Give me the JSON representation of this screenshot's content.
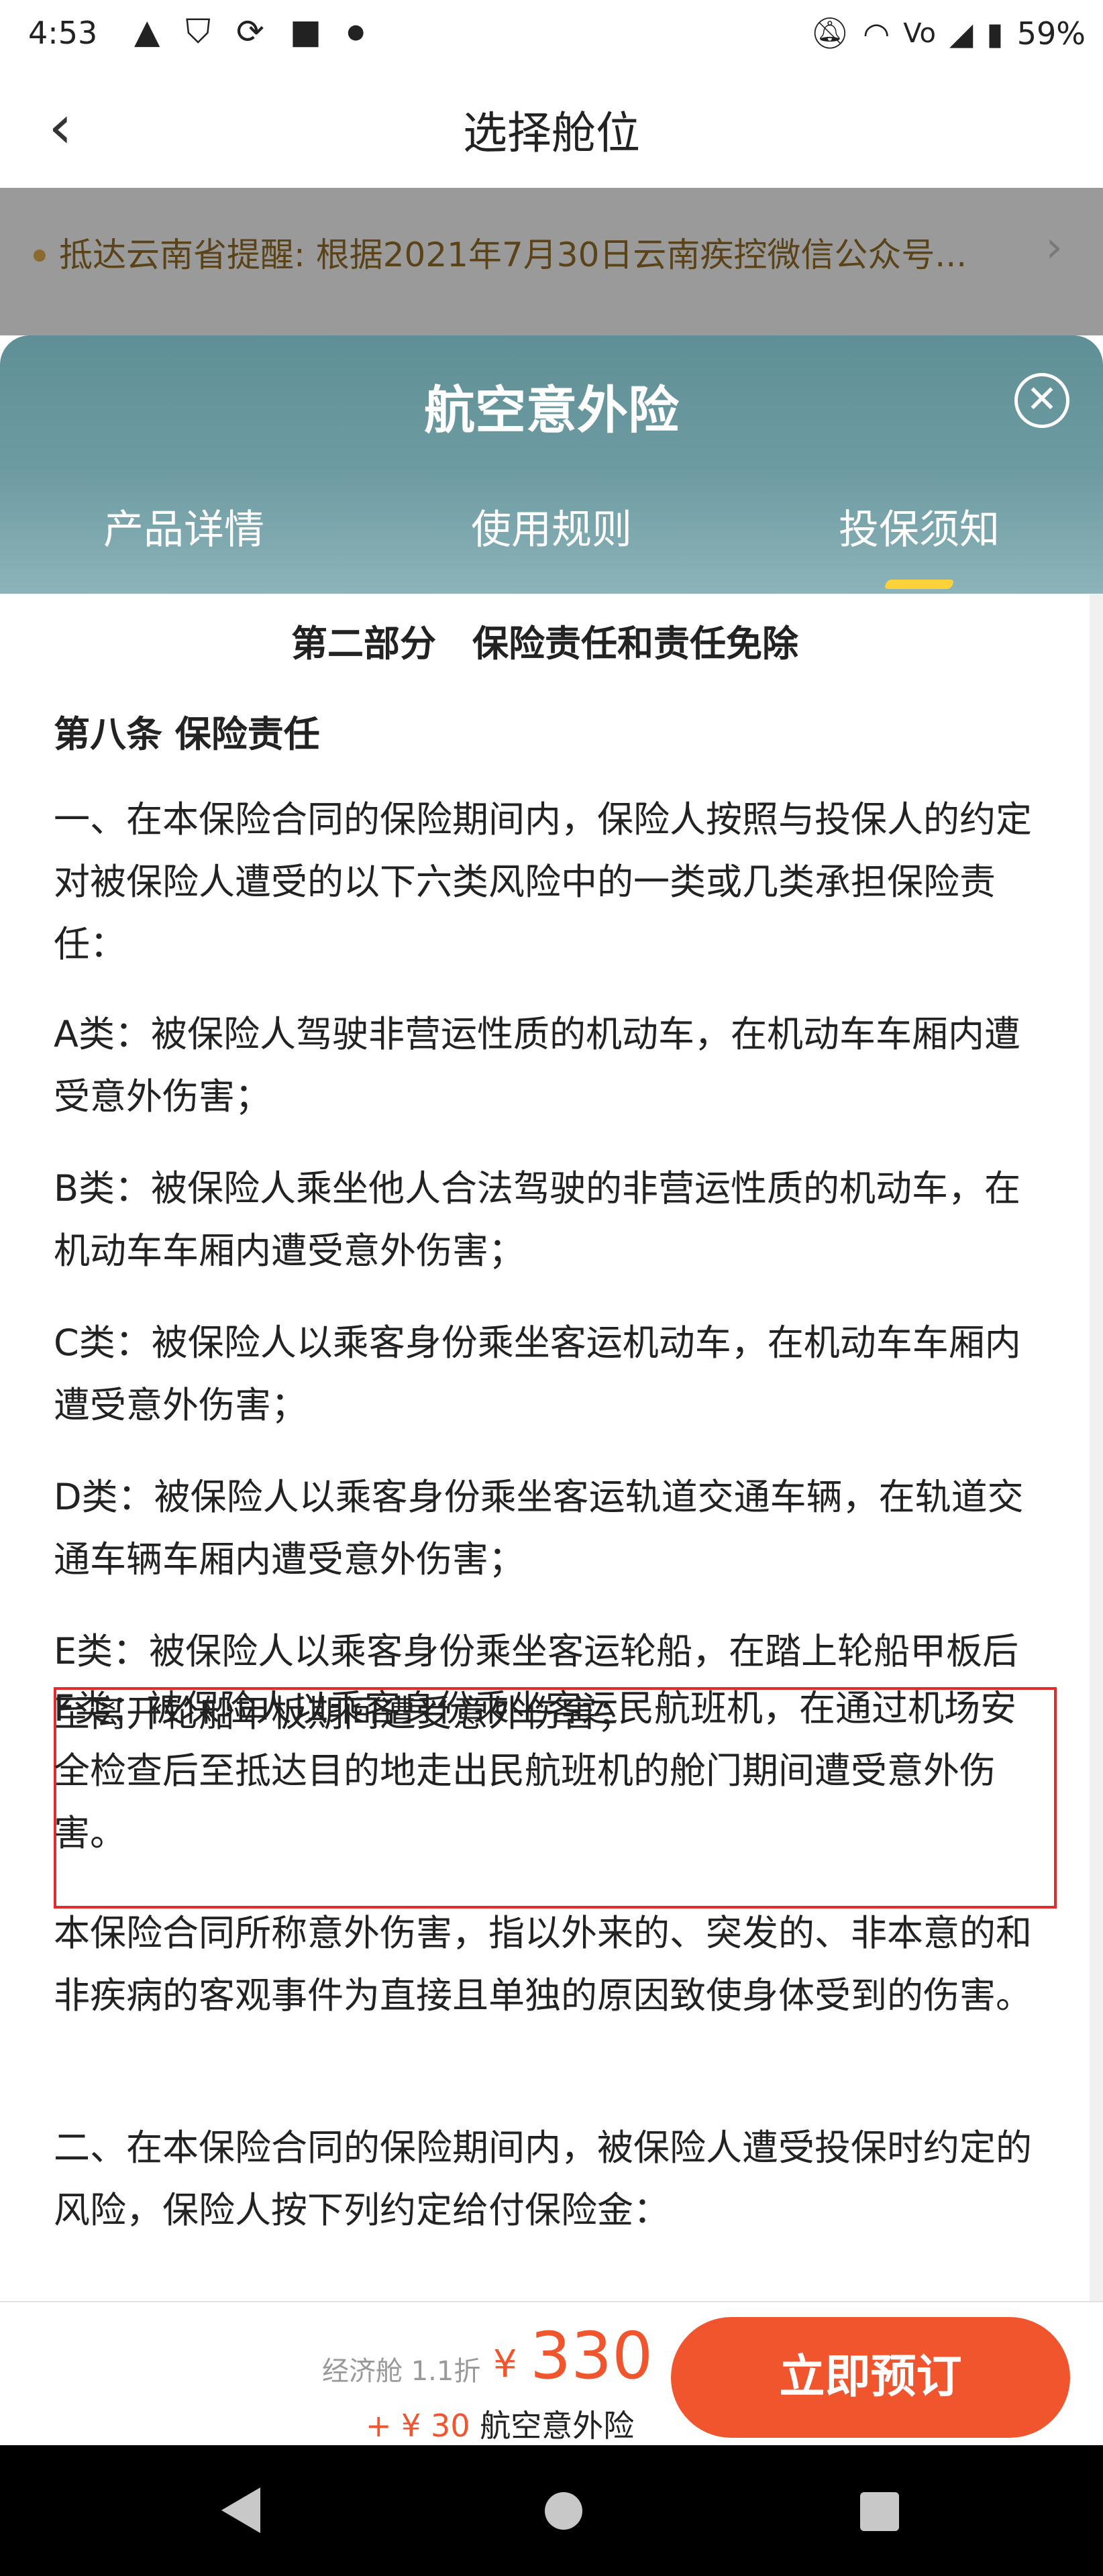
{
  "status_bar": {
    "time": "4:53",
    "battery": "59%",
    "icons_left": [
      "a-icon",
      "shield-icon",
      "sync-icon",
      "square-icon",
      "dot-icon"
    ],
    "icons_right": [
      "mute-icon",
      "wifi-icon",
      "volte-icon",
      "signal-icon",
      "battery-icon"
    ]
  },
  "header": {
    "title": "选择舱位",
    "back_glyph": "‹"
  },
  "notice": {
    "text": "抵达云南省提醒: 根据2021年7月30日云南疾控微信公众号...",
    "arrow_glyph": "›"
  },
  "modal": {
    "title": "航空意外险",
    "close_glyph": "✕",
    "tabs": [
      {
        "label": "产品详情",
        "active": false
      },
      {
        "label": "使用规则",
        "active": false
      },
      {
        "label": "投保须知",
        "active": true
      }
    ],
    "content": {
      "section_title": "第二部分　保险责任和责任免除",
      "article_title": "第八条 保险责任",
      "paragraphs": [
        "一、在本保险合同的保险期间内，保险人按照与投保人的约定对被保险人遭受的以下六类风险中的一类或几类承担保险责任：",
        "A类：被保险人驾驶非营运性质的机动车，在机动车车厢内遭受意外伤害；",
        "B类：被保险人乘坐他人合法驾驶的非营运性质的机动车，在机动车车厢内遭受意外伤害；",
        "C类：被保险人以乘客身份乘坐客运机动车，在机动车车厢内遭受意外伤害；",
        "D类：被保险人以乘客身份乘坐客运轨道交通车辆，在轨道交通车辆车厢内遭受意外伤害；",
        "E类：被保险人以乘客身份乘坐客运轮船，在踏上轮船甲板后至离开轮船甲板期间遭受意外伤害；",
        "F类：被保险人以乘客身份乘坐客运民航班机，在通过机场安全检查后至抵达目的地走出民航班机的舱门期间遭受意外伤害。",
        "本保险合同所称意外伤害，指以外来的、突发的、非本意的和非疾病的客观事件为直接且单独的原因致使身体受到的伤害。",
        "二、在本保险合同的保险期间内，被保险人遭受投保时约定的风险，保险人按下列约定给付保险金："
      ]
    }
  },
  "bottom_bar": {
    "cabin_label": "经济舱 1.1折",
    "currency": "¥",
    "price": "330",
    "addon_price": "+ ¥ 30",
    "addon_name": "航空意外险",
    "book_label": "立即预订"
  },
  "colors": {
    "accent": "#f0552e",
    "sheet_header": "#6f9ca3",
    "tab_indicator": "#ffd23a",
    "highlight_border": "#e32b2b"
  }
}
